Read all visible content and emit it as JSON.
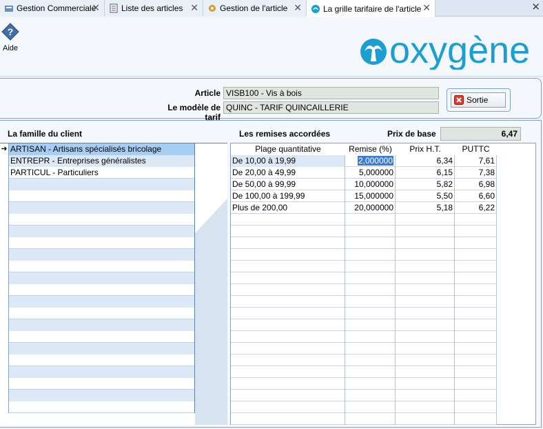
{
  "tabs": [
    {
      "label": "Gestion Commerciale",
      "icon": "app-icon"
    },
    {
      "label": "Liste des articles",
      "icon": "list-icon"
    },
    {
      "label": "Gestion de l'article",
      "icon": "gear-icon"
    },
    {
      "label": "La grille tarifaire de l'article",
      "icon": "oxygene-icon",
      "active": true
    }
  ],
  "toolbar": {
    "help_label": "Aide",
    "logo_text": "oxygène"
  },
  "header": {
    "article_label": "Article",
    "article_value": "VISB100 - Vis à  bois",
    "model_label": "Le modèle de tarif",
    "model_value": "QUINC - TARIF QUINCAILLERIE",
    "exit_label": "Sortie"
  },
  "left": {
    "title": "La famille du client",
    "rows": [
      "ARTISAN - Artisans spécialisés bricolage",
      "ENTREPR - Entreprises généralistes",
      "PARTICUL - Particuliers"
    ]
  },
  "right": {
    "title": "Les remises accordées",
    "base_price_label": "Prix de base",
    "base_price_value": "6,47",
    "columns": [
      "Plage quantitative",
      "Remise (%)",
      "Prix H.T.",
      "PUTTC"
    ],
    "rows": [
      [
        "De 10,00 à 19,99",
        "2,000000",
        "6,34",
        "7,61"
      ],
      [
        "De 20,00 à 49,99",
        "5,000000",
        "6,15",
        "7,38"
      ],
      [
        "De 50,00 à 99,99",
        "10,000000",
        "5,82",
        "6,98"
      ],
      [
        "De 100,00 à 199,99",
        "15,000000",
        "5,50",
        "6,60"
      ],
      [
        "Plus de 200,00",
        "20,000000",
        "5,18",
        "6,22"
      ]
    ]
  },
  "colors": {
    "accent": "#1a9fd0",
    "selected_row": "#a8cdf3",
    "alt_row": "#dde8f6",
    "border": "#7aa3cf"
  }
}
